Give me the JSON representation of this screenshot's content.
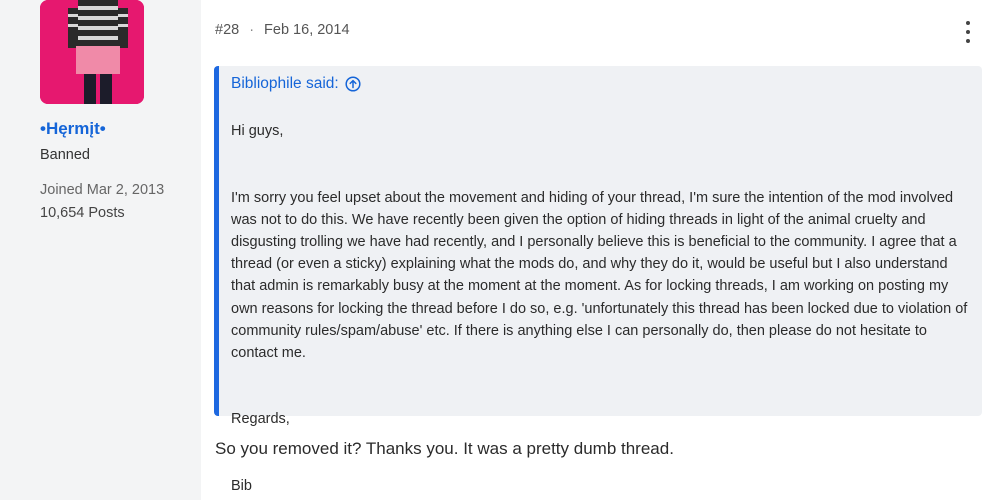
{
  "user": {
    "name": "•Hęrmįt•",
    "title": "Banned",
    "joined": "Joined Mar 2, 2013",
    "posts": "10,654 Posts",
    "colors": {
      "avatar_bg": "#e6186f",
      "name": "#1565d8"
    }
  },
  "post": {
    "number": "#28",
    "separator": "·",
    "date": "Feb 16, 2014",
    "menu_icon": "more-vertical-icon",
    "quote": {
      "author_said": "Bibliophile said:",
      "icon": "arrow-up-circle-icon",
      "paragraphs": [
        "Hi guys,",
        "I'm sorry you feel upset about the movement and hiding of your thread, I'm sure the intention of the mod involved was not to do this. We have recently been given the option of hiding threads in light of the animal cruelty and disgusting trolling we have had recently, and I personally believe this is beneficial to the community. I agree that a thread (or even a sticky) explaining what the mods do, and why they do it, would be useful but I also understand that admin is remarkably busy at the moment at the moment. As for locking threads, I am working on posting my own reasons for locking the thread before I do so, e.g. 'unfortunately this thread has been locked due to violation of community rules/spam/abuse' etc. If there is anything else I can personally do, then please do not hesitate to contact me.",
        "Regards,",
        "Bib"
      ]
    },
    "reply": "So you removed it? Thanks you. It was a pretty dumb thread.",
    "colors": {
      "quote_bar": "#1d68e0",
      "quote_bg": "#eff1f4",
      "link": "#1565d8"
    }
  }
}
